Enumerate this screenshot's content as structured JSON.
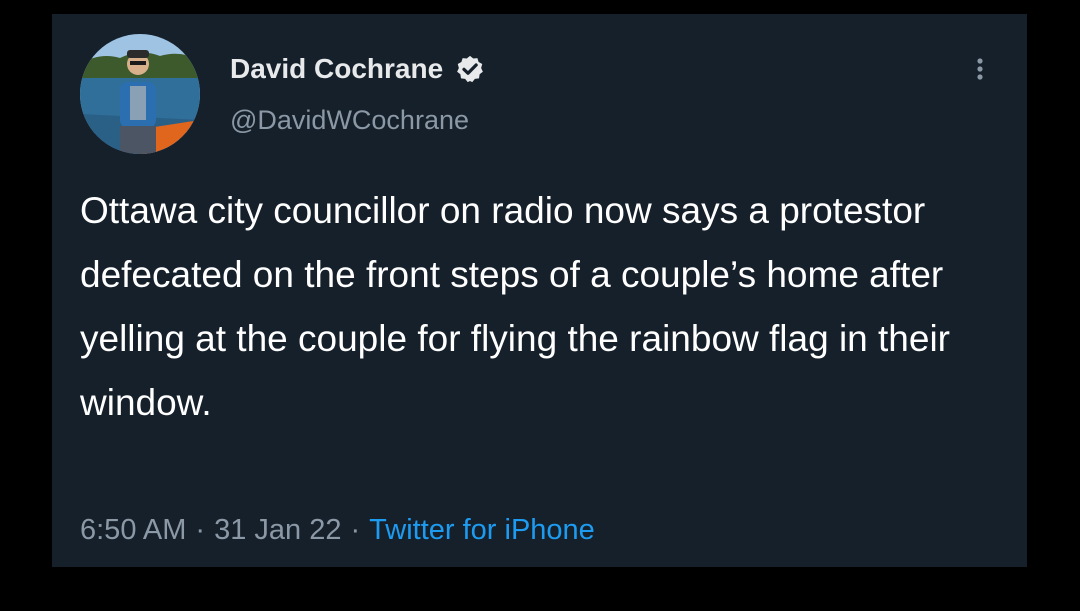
{
  "author": {
    "display_name": "David Cochrane",
    "handle": "@DavidWCochrane",
    "verified": true,
    "verified_color": "#e7e9ea"
  },
  "tweet": {
    "text": "Ottawa city councillor on radio now says a protestor defecated on the front steps of a couple’s home after yelling at the couple for flying the rainbow flag in their window.",
    "time": "6:50 AM",
    "separator": "·",
    "date": "31 Jan 22",
    "source": "Twitter for iPhone",
    "source_color": "#1d9bf0"
  },
  "icons": {
    "more": "more-vertical-icon",
    "verified": "verified-badge-icon"
  }
}
